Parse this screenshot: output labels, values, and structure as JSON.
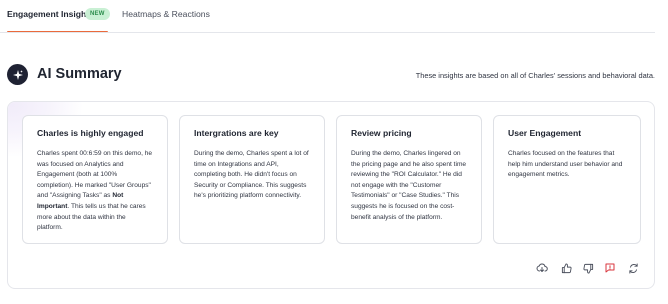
{
  "tabs": {
    "active_label": "Engagement Insights",
    "active_badge": "NEW",
    "second_label": "Heatmaps & Reactions"
  },
  "header": {
    "title": "AI Summary",
    "note": "These insights are based on all of Charles' sessions and behavioral data.",
    "icon": "sparkle-icon"
  },
  "cards": [
    {
      "title": "Charles is highly engaged",
      "body_before": "Charles spent 00:6:59 on this demo, he was focused on Analytics and Engagement (both at 100% completion). He marked \"User Groups\" and \"Assigning Tasks\" as ",
      "body_strong": "Not Important",
      "body_after": ". This tells us that he cares more about the data within the platform."
    },
    {
      "title": "Intergrations are key",
      "body": "During the demo, Charles spent a lot of time on Integrations and API, completing both. He didn't focus on Security or Compliance. This suggests he's prioritizing platform connectivity."
    },
    {
      "title": "Review pricing",
      "body": "During the demo, Charles lingered on the pricing page and he also spent time reviewing the \"ROI Calculator.\" He did not engage with the \"Customer Testimonials\" or \"Case Studies.\" This suggests he is focused on the cost-benefit analysis of the platform."
    },
    {
      "title": "User Engagement",
      "body": "Charles focused on the features that help him understand user behavior and engagement metrics."
    }
  ],
  "actions": [
    "cloud-download-icon",
    "thumbs-up-icon",
    "thumbs-down-icon",
    "flag-comment-icon",
    "refresh-icon"
  ],
  "colors": {
    "accent_underline": "#ea6a3c",
    "badge_bg": "#c9f0d4",
    "badge_text": "#2b8c4b",
    "flag_icon": "#d9363e",
    "title_icon_bg": "#1f2233"
  }
}
